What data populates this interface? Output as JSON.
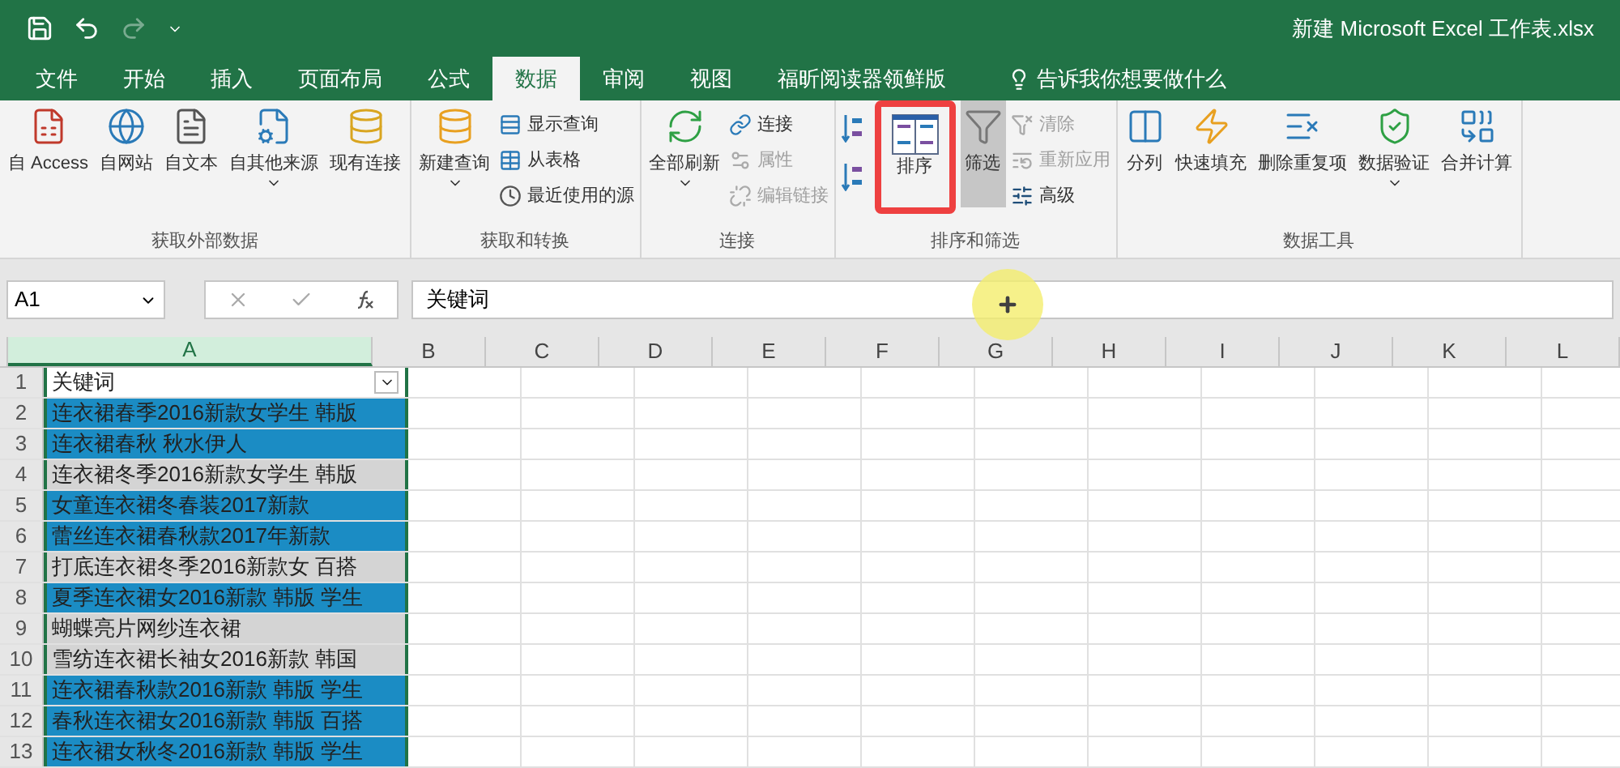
{
  "title_bar": {
    "quick_access": [
      {
        "kind": "save",
        "disabled": false
      },
      {
        "kind": "undo",
        "disabled": false
      },
      {
        "kind": "redo",
        "disabled": true
      },
      {
        "kind": "customize",
        "disabled": false
      }
    ],
    "title": "新建 Microsoft Excel 工作表.xlsx"
  },
  "tabs": [
    {
      "label": "文件",
      "selected": false
    },
    {
      "label": "开始",
      "selected": false
    },
    {
      "label": "插入",
      "selected": false
    },
    {
      "label": "页面布局",
      "selected": false
    },
    {
      "label": "公式",
      "selected": false
    },
    {
      "label": "数据",
      "selected": true
    },
    {
      "label": "审阅",
      "selected": false
    },
    {
      "label": "视图",
      "selected": false
    },
    {
      "label": "福昕阅读器领鲜版",
      "selected": false
    }
  ],
  "tell_me": {
    "placeholder": "告诉我你想要做什么"
  },
  "ribbon": {
    "groups": [
      {
        "label": "获取外部数据",
        "items": [
          {
            "kind": "large",
            "label": "自 Access"
          },
          {
            "kind": "large",
            "label": "自网站"
          },
          {
            "kind": "large",
            "label": "自文本"
          },
          {
            "kind": "large",
            "label": "自其他来源",
            "dropdown": true
          },
          {
            "kind": "large",
            "label": "现有连接"
          }
        ]
      },
      {
        "label": "获取和转换",
        "items": [
          {
            "kind": "large",
            "label": "新建查询",
            "dropdown": true
          },
          {
            "kind": "small",
            "label": "显示查询",
            "disabled": false
          },
          {
            "kind": "small",
            "label": "从表格",
            "disabled": false
          },
          {
            "kind": "small",
            "label": "最近使用的源",
            "disabled": false
          }
        ]
      },
      {
        "label": "连接",
        "items": [
          {
            "kind": "large",
            "label": "全部刷新",
            "dropdown": true
          },
          {
            "kind": "small",
            "label": "连接",
            "disabled": false
          },
          {
            "kind": "small",
            "label": "属性",
            "disabled": true
          },
          {
            "kind": "small",
            "label": "编辑链接",
            "disabled": true
          }
        ]
      },
      {
        "label": "排序和筛选",
        "items": [
          {
            "kind": "sort_pair"
          },
          {
            "kind": "large",
            "label": "排序",
            "highlighted": true
          },
          {
            "kind": "large",
            "label": "筛选",
            "selected": true
          },
          {
            "kind": "small",
            "label": "清除",
            "disabled": true
          },
          {
            "kind": "small",
            "label": "重新应用",
            "disabled": true
          },
          {
            "kind": "small",
            "label": "高级",
            "disabled": false
          }
        ]
      },
      {
        "label": "数据工具",
        "items": [
          {
            "kind": "large",
            "label": "分列"
          },
          {
            "kind": "large",
            "label": "快速填充"
          },
          {
            "kind": "large",
            "label": "删除重复项"
          },
          {
            "kind": "large",
            "label": "数据验证",
            "dropdown": true
          },
          {
            "kind": "large",
            "label": "合并计算"
          }
        ]
      }
    ]
  },
  "formula_bar": {
    "name_box": "A1",
    "value": "关键词"
  },
  "sheet": {
    "columns": [
      {
        "label": "A",
        "selected": true
      },
      {
        "label": "B",
        "selected": false
      },
      {
        "label": "C",
        "selected": false
      },
      {
        "label": "D",
        "selected": false
      },
      {
        "label": "E",
        "selected": false
      },
      {
        "label": "F",
        "selected": false
      },
      {
        "label": "G",
        "selected": false
      },
      {
        "label": "H",
        "selected": false
      },
      {
        "label": "I",
        "selected": false
      },
      {
        "label": "J",
        "selected": false
      },
      {
        "label": "K",
        "selected": false
      },
      {
        "label": "L",
        "selected": false
      }
    ],
    "rows": [
      {
        "number": "1",
        "cell": "关键词",
        "filter": true
      },
      {
        "number": "2",
        "cell": "连衣裙春季2016新款女学生 韩版",
        "color": "#1b8cc4"
      },
      {
        "number": "3",
        "cell": "连衣裙春秋 秋水伊人",
        "color": "#1b8cc4"
      },
      {
        "number": "4",
        "cell": "连衣裙冬季2016新款女学生 韩版",
        "color": "#d4d4d4"
      },
      {
        "number": "5",
        "cell": "女童连衣裙冬春装2017新款",
        "color": "#1b8cc4"
      },
      {
        "number": "6",
        "cell": "蕾丝连衣裙春秋款2017年新款",
        "color": "#1b8cc4"
      },
      {
        "number": "7",
        "cell": "打底连衣裙冬季2016新款女 百搭",
        "color": "#d4d4d4"
      },
      {
        "number": "8",
        "cell": "夏季连衣裙女2016新款 韩版 学生",
        "color": "#1b8cc4"
      },
      {
        "number": "9",
        "cell": "蝴蝶亮片网纱连衣裙",
        "color": "#d4d4d4"
      },
      {
        "number": "10",
        "cell": "雪纺连衣裙长袖女2016新款 韩国",
        "color": "#d4d4d4"
      },
      {
        "number": "11",
        "cell": "连衣裙春秋款2016新款 韩版 学生",
        "color": "#1b8cc4"
      },
      {
        "number": "12",
        "cell": "春秋连衣裙女2016新款 韩版 百搭",
        "color": "#1b8cc4"
      },
      {
        "number": "13",
        "cell": "连衣裙女秋冬2016新款 韩版 学生",
        "color": "#1b8cc4"
      }
    ]
  }
}
